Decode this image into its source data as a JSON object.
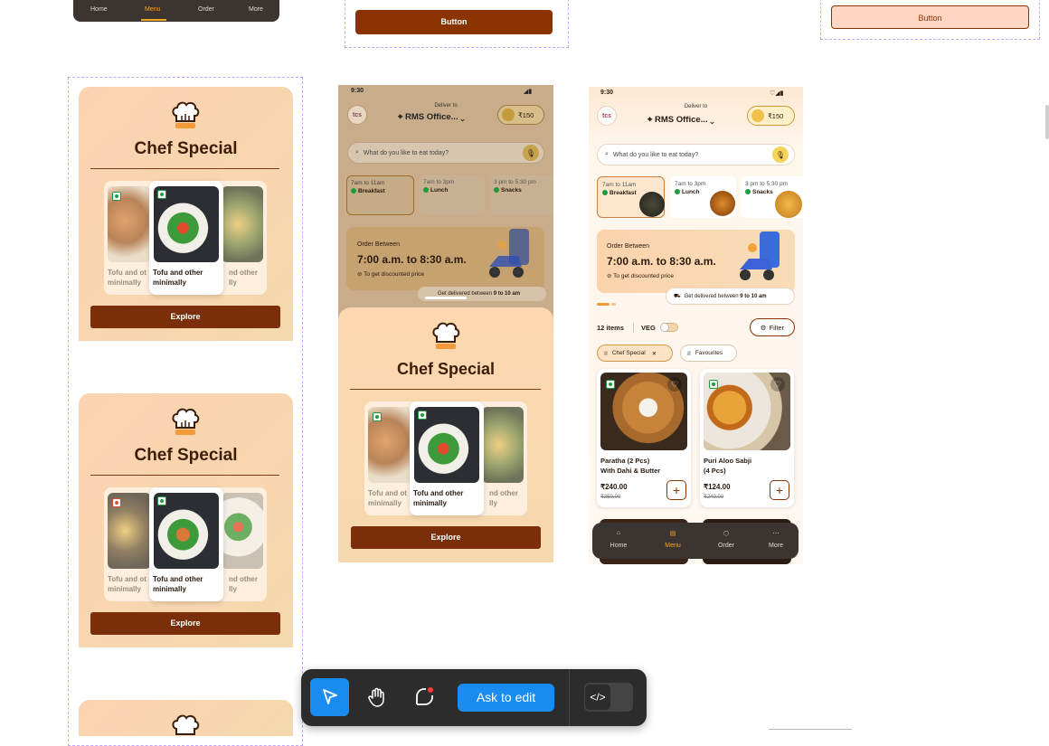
{
  "top": {
    "nav": [
      "Home",
      "Menu",
      "Order",
      "More"
    ],
    "button1": "Button",
    "button2": "Button"
  },
  "chef": {
    "title": "Chef Special",
    "caption_left": "Tofu and ot\nminimally",
    "caption_center": "Tofu and other\nminimally",
    "caption_right": "nd other\nlly",
    "explore": "Explore"
  },
  "phone2": {
    "chef_caption_left": "Tofu and ot\nminimally",
    "chef_caption_center": "Tofu and other\nminimally",
    "chef_caption_right": "nd other\nlly",
    "delivery_full": "Get delivered between",
    "delivery_full_time": "9 to 10 am"
  },
  "phone": {
    "time": "9:30",
    "deliver_to": "Deliver to",
    "location": "RMS Office...",
    "wallet": "₹150",
    "search_placeholder": "What do you like to eat today?",
    "slots": [
      {
        "time": "7am to 11am",
        "label": "Breakfast"
      },
      {
        "time": "7am to 3pm",
        "label": "Lunch"
      },
      {
        "time": "3 pm to 5:30 pm",
        "label": "Snacks"
      }
    ],
    "order_between": "Order Between",
    "order_time": "7:00 a.m. to 8:30 a.m.",
    "discount": "To get discounted price",
    "delivery": "Get delivered between",
    "delivery_time": "9 to 10 am",
    "logo": "tcs"
  },
  "menu": {
    "items_count": "12 items",
    "veg": "VEG",
    "filter": "Filter",
    "chip_chef": "Chef Special",
    "chip_fav": "Favourites",
    "products": [
      {
        "name": "Paratha (2 Pcs)\nWith Dahi & Butter",
        "price": "₹240.00",
        "old": "₹350.00"
      },
      {
        "name": "Puri Aloo Sabji\n(4 Pcs)",
        "price": "₹124.00",
        "old": "₹240.00"
      }
    ],
    "nav": [
      "Home",
      "Menu",
      "Order",
      "More"
    ]
  },
  "toolbar": {
    "ask": "Ask to edit"
  },
  "colors": {
    "brown": "#8a3300",
    "peach": "#f6d8b0",
    "accent_blue": "#1a8cf0",
    "veg_green": "#1d9b3d"
  }
}
